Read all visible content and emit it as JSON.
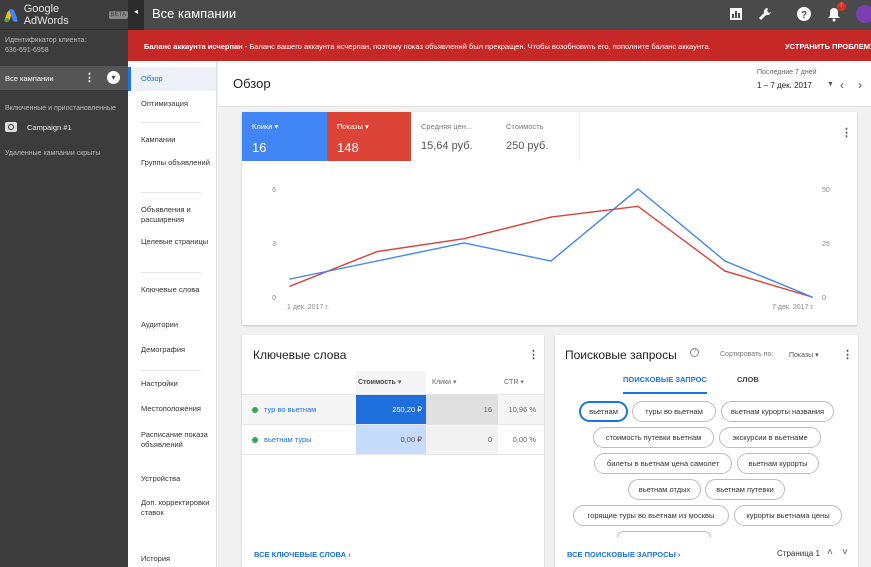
{
  "brand": {
    "name": "Google AdWords",
    "badge": "BETA"
  },
  "client": {
    "label": "Идентификатор клиента:",
    "id": "636-691-6958"
  },
  "leftnav": {
    "all_campaigns": "Все кампании",
    "filter_note": "Включенные и приостановленные",
    "campaign": "Campaign #1",
    "hidden_note": "Удаленные кампании скрыты"
  },
  "header": {
    "title": "Все кампании",
    "notif_count": "!",
    "avatar_letter": ""
  },
  "alert": {
    "bold": "Баланс аккаунта исчерпан",
    "text": " - Баланс вашего аккаунта исчерпан, поэтому показ объявлений был прекращен. Чтобы возобновить его, пополните баланс аккаунта.",
    "action": "УСТРАНИТЬ ПРОБЛЕМУ"
  },
  "subnav": [
    "Обзор",
    "Оптимизация",
    "Кампании",
    "Группы объявлений",
    "Объявления и расширения",
    "Целевые страницы",
    "Ключевые слова",
    "Аудитории",
    "Демография",
    "Настройки",
    "Местоположения",
    "Расписание показа объявлений",
    "Устройства",
    "Доп. корректировки ставок",
    "История"
  ],
  "page": {
    "title": "Обзор",
    "date_label": "Последние 7 дней",
    "date_range": "1 – 7 дек. 2017"
  },
  "metrics": {
    "clicks_label": "Клики",
    "clicks_value": "16",
    "impr_label": "Показы",
    "impr_value": "148",
    "cpc_label": "Средняя цен...",
    "cpc_value": "15,64 руб.",
    "cost_label": "Стоимость",
    "cost_value": "250 руб."
  },
  "chart_data": {
    "type": "line",
    "x": [
      "1 дек. 2017 г.",
      "2 дек.",
      "3 дек.",
      "4 дек.",
      "5 дек.",
      "6 дек.",
      "7 дек. 2017 г."
    ],
    "x_tick_labels": [
      "1 дек. 2017 г.",
      "7 дек. 2017 г."
    ],
    "y_left_ticks": [
      "0",
      "3",
      "6"
    ],
    "y_right_ticks": [
      "0",
      "25",
      "50"
    ],
    "ylim_left": [
      0,
      6
    ],
    "ylim_right": [
      0,
      50
    ],
    "series": [
      {
        "name": "Клики",
        "axis": "left",
        "color": "#4285f4",
        "values": [
          1,
          2,
          3,
          2,
          6,
          2,
          0
        ]
      },
      {
        "name": "Показы",
        "axis": "right",
        "color": "#db4437",
        "values": [
          5,
          21,
          27,
          37,
          42,
          12,
          0
        ]
      }
    ],
    "grid": false
  },
  "keywords": {
    "title": "Ключевые слова",
    "columns": [
      "Стоимость",
      "Клики",
      "CTR"
    ],
    "rows": [
      {
        "keyword": "тур во вьетнам",
        "cost": "250,20 ₽",
        "clicks": "16",
        "ctr": "10,96 %"
      },
      {
        "keyword": "вьетнам туры",
        "cost": "0,00 ₽",
        "clicks": "0",
        "ctr": "0,00 %"
      }
    ],
    "more": "ВСЕ КЛЮЧЕВЫЕ СЛОВА"
  },
  "queries": {
    "title": "Поисковые запросы",
    "sort_label": "Сортировать по:",
    "sort_value": "Показы",
    "tab_active": "ПОИСКОВЫЕ ЗАПРОСЫ",
    "tab_other": "СЛОВ",
    "chips": [
      "вьетнам",
      "туры во вьетнам",
      "вьетнам курорты названия",
      "стоимость путевки вьетнам",
      "экскурсии в вьетнаме",
      "билеты в вьетнам цена самолет",
      "вьетнам курорты",
      "вьетнам отдых",
      "вьетнам путевки",
      "горящие туры во вьетнам из москвы",
      "курорты вьетнама цены"
    ],
    "more": "ВСЕ ПОИСКОВЫЕ ЗАПРОСЫ",
    "page": "Страница 1"
  },
  "colors": {
    "clicks": "#4285f4",
    "impressions": "#db4437",
    "alert": "#c62828",
    "link": "#1a73e8"
  }
}
